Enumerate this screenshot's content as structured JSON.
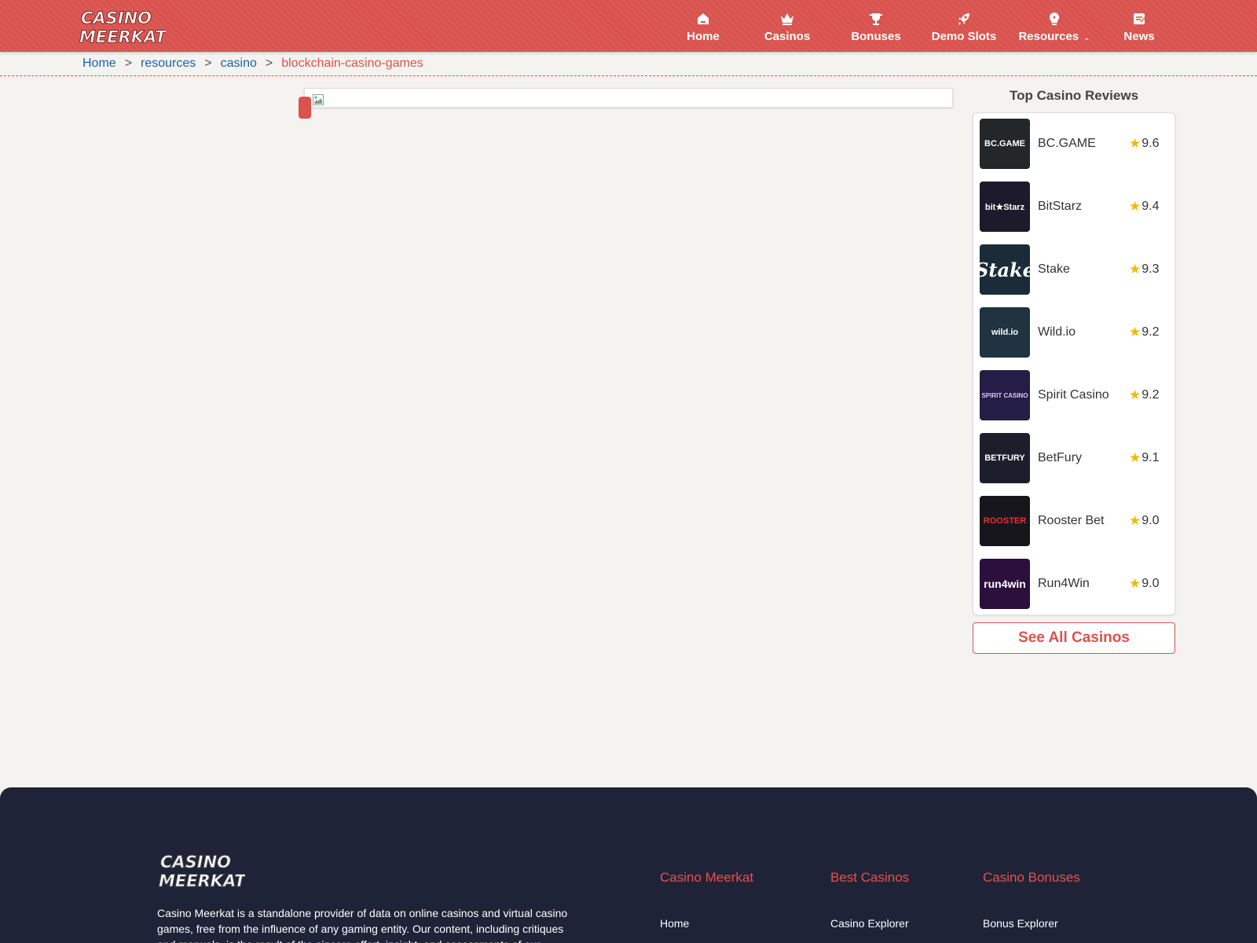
{
  "brand": {
    "line1": "CASINO",
    "line2": "MEERKAT",
    "primary_color": "#d9534f"
  },
  "nav": {
    "items": [
      {
        "label": "Home",
        "icon": "home-icon"
      },
      {
        "label": "Casinos",
        "icon": "crown-icon"
      },
      {
        "label": "Bonuses",
        "icon": "trophy-icon"
      },
      {
        "label": "Demo Slots",
        "icon": "rocket-icon"
      },
      {
        "label": "Resources",
        "icon": "lightbulb-icon",
        "has_dropdown": true
      },
      {
        "label": "News",
        "icon": "news-icon"
      }
    ]
  },
  "breadcrumb": {
    "items": [
      "Home",
      "resources",
      "casino"
    ],
    "separator": ">",
    "current": "blockchain-casino-games"
  },
  "sidebar": {
    "title": "Top Casino Reviews",
    "reviews": [
      {
        "name": "BC.GAME",
        "rating": "9.6",
        "logo_text": "BC.GAME",
        "logo_bg": "#23272a",
        "logo_fg": "#ffffff"
      },
      {
        "name": "BitStarz",
        "rating": "9.4",
        "logo_text": "bit★Starz",
        "logo_bg": "#1d1b2b",
        "logo_fg": "#ffffff"
      },
      {
        "name": "Stake",
        "rating": "9.3",
        "logo_text": "Stake",
        "logo_bg": "#1a2c38",
        "logo_fg": "#ffffff"
      },
      {
        "name": "Wild.io",
        "rating": "9.2",
        "logo_text": "wild.io",
        "logo_bg": "#1f3340",
        "logo_fg": "#ffffff"
      },
      {
        "name": "Spirit Casino",
        "rating": "9.2",
        "logo_text": "SPIRIT CASINO",
        "logo_bg": "#241d45",
        "logo_fg": "#d9c8ff"
      },
      {
        "name": "BetFury",
        "rating": "9.1",
        "logo_text": "BETFURY",
        "logo_bg": "#1c1f2b",
        "logo_fg": "#ffffff"
      },
      {
        "name": "Rooster Bet",
        "rating": "9.0",
        "logo_text": "ROOSTER",
        "logo_bg": "#17161c",
        "logo_fg": "#e8312e"
      },
      {
        "name": "Run4Win",
        "rating": "9.0",
        "logo_text": "run4win",
        "logo_bg": "#2b0f3d",
        "logo_fg": "#ffffff"
      }
    ],
    "see_all_label": "See All Casinos"
  },
  "footer": {
    "description": "Casino Meerkat is a standalone provider of data on online casinos and virtual casino games, free from the influence of any gaming entity. Our content, including critiques and manuals, is the result of the sincere effort, insight, and assessments of our",
    "columns": [
      {
        "title": "Casino Meerkat",
        "first_link": "Home"
      },
      {
        "title": "Best Casinos",
        "first_link": "Casino Explorer"
      },
      {
        "title": "Casino Bonuses",
        "first_link": "Bonus Explorer"
      }
    ]
  }
}
